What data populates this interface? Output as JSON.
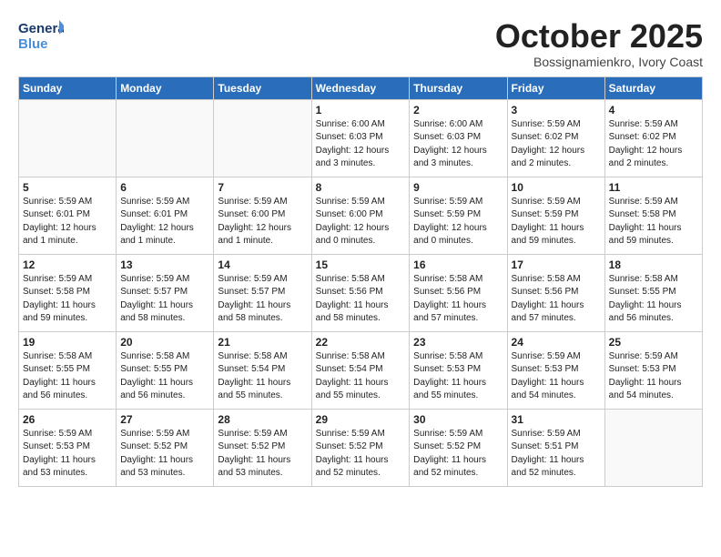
{
  "logo": {
    "line1": "General",
    "line2": "Blue"
  },
  "title": "October 2025",
  "subtitle": "Bossignamienkro, Ivory Coast",
  "days_header": [
    "Sunday",
    "Monday",
    "Tuesday",
    "Wednesday",
    "Thursday",
    "Friday",
    "Saturday"
  ],
  "weeks": [
    [
      {
        "num": "",
        "info": ""
      },
      {
        "num": "",
        "info": ""
      },
      {
        "num": "",
        "info": ""
      },
      {
        "num": "1",
        "info": "Sunrise: 6:00 AM\nSunset: 6:03 PM\nDaylight: 12 hours\nand 3 minutes."
      },
      {
        "num": "2",
        "info": "Sunrise: 6:00 AM\nSunset: 6:03 PM\nDaylight: 12 hours\nand 3 minutes."
      },
      {
        "num": "3",
        "info": "Sunrise: 5:59 AM\nSunset: 6:02 PM\nDaylight: 12 hours\nand 2 minutes."
      },
      {
        "num": "4",
        "info": "Sunrise: 5:59 AM\nSunset: 6:02 PM\nDaylight: 12 hours\nand 2 minutes."
      }
    ],
    [
      {
        "num": "5",
        "info": "Sunrise: 5:59 AM\nSunset: 6:01 PM\nDaylight: 12 hours\nand 1 minute."
      },
      {
        "num": "6",
        "info": "Sunrise: 5:59 AM\nSunset: 6:01 PM\nDaylight: 12 hours\nand 1 minute."
      },
      {
        "num": "7",
        "info": "Sunrise: 5:59 AM\nSunset: 6:00 PM\nDaylight: 12 hours\nand 1 minute."
      },
      {
        "num": "8",
        "info": "Sunrise: 5:59 AM\nSunset: 6:00 PM\nDaylight: 12 hours\nand 0 minutes."
      },
      {
        "num": "9",
        "info": "Sunrise: 5:59 AM\nSunset: 5:59 PM\nDaylight: 12 hours\nand 0 minutes."
      },
      {
        "num": "10",
        "info": "Sunrise: 5:59 AM\nSunset: 5:59 PM\nDaylight: 11 hours\nand 59 minutes."
      },
      {
        "num": "11",
        "info": "Sunrise: 5:59 AM\nSunset: 5:58 PM\nDaylight: 11 hours\nand 59 minutes."
      }
    ],
    [
      {
        "num": "12",
        "info": "Sunrise: 5:59 AM\nSunset: 5:58 PM\nDaylight: 11 hours\nand 59 minutes."
      },
      {
        "num": "13",
        "info": "Sunrise: 5:59 AM\nSunset: 5:57 PM\nDaylight: 11 hours\nand 58 minutes."
      },
      {
        "num": "14",
        "info": "Sunrise: 5:59 AM\nSunset: 5:57 PM\nDaylight: 11 hours\nand 58 minutes."
      },
      {
        "num": "15",
        "info": "Sunrise: 5:58 AM\nSunset: 5:56 PM\nDaylight: 11 hours\nand 58 minutes."
      },
      {
        "num": "16",
        "info": "Sunrise: 5:58 AM\nSunset: 5:56 PM\nDaylight: 11 hours\nand 57 minutes."
      },
      {
        "num": "17",
        "info": "Sunrise: 5:58 AM\nSunset: 5:56 PM\nDaylight: 11 hours\nand 57 minutes."
      },
      {
        "num": "18",
        "info": "Sunrise: 5:58 AM\nSunset: 5:55 PM\nDaylight: 11 hours\nand 56 minutes."
      }
    ],
    [
      {
        "num": "19",
        "info": "Sunrise: 5:58 AM\nSunset: 5:55 PM\nDaylight: 11 hours\nand 56 minutes."
      },
      {
        "num": "20",
        "info": "Sunrise: 5:58 AM\nSunset: 5:55 PM\nDaylight: 11 hours\nand 56 minutes."
      },
      {
        "num": "21",
        "info": "Sunrise: 5:58 AM\nSunset: 5:54 PM\nDaylight: 11 hours\nand 55 minutes."
      },
      {
        "num": "22",
        "info": "Sunrise: 5:58 AM\nSunset: 5:54 PM\nDaylight: 11 hours\nand 55 minutes."
      },
      {
        "num": "23",
        "info": "Sunrise: 5:58 AM\nSunset: 5:53 PM\nDaylight: 11 hours\nand 55 minutes."
      },
      {
        "num": "24",
        "info": "Sunrise: 5:59 AM\nSunset: 5:53 PM\nDaylight: 11 hours\nand 54 minutes."
      },
      {
        "num": "25",
        "info": "Sunrise: 5:59 AM\nSunset: 5:53 PM\nDaylight: 11 hours\nand 54 minutes."
      }
    ],
    [
      {
        "num": "26",
        "info": "Sunrise: 5:59 AM\nSunset: 5:53 PM\nDaylight: 11 hours\nand 53 minutes."
      },
      {
        "num": "27",
        "info": "Sunrise: 5:59 AM\nSunset: 5:52 PM\nDaylight: 11 hours\nand 53 minutes."
      },
      {
        "num": "28",
        "info": "Sunrise: 5:59 AM\nSunset: 5:52 PM\nDaylight: 11 hours\nand 53 minutes."
      },
      {
        "num": "29",
        "info": "Sunrise: 5:59 AM\nSunset: 5:52 PM\nDaylight: 11 hours\nand 52 minutes."
      },
      {
        "num": "30",
        "info": "Sunrise: 5:59 AM\nSunset: 5:52 PM\nDaylight: 11 hours\nand 52 minutes."
      },
      {
        "num": "31",
        "info": "Sunrise: 5:59 AM\nSunset: 5:51 PM\nDaylight: 11 hours\nand 52 minutes."
      },
      {
        "num": "",
        "info": ""
      }
    ]
  ]
}
